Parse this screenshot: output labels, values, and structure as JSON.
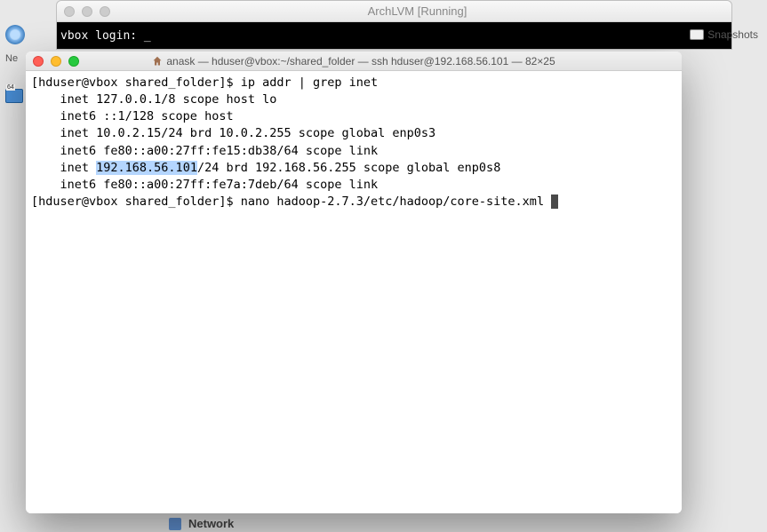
{
  "vm_window": {
    "title": "ArchLVM [Running]",
    "login_prompt": "vbox login: _"
  },
  "snapshots": {
    "label": "Snapshots"
  },
  "left": {
    "ne_label": "Ne"
  },
  "network": {
    "label": "Network"
  },
  "terminal": {
    "title": "anask — hduser@vbox:~/shared_folder — ssh hduser@192.168.56.101 — 82×25",
    "lines": {
      "l1_prompt": "[hduser@vbox shared_folder]$ ",
      "l1_cmd": "ip addr | grep inet",
      "l2": "    inet 127.0.0.1/8 scope host lo",
      "l3": "    inet6 ::1/128 scope host ",
      "l4": "    inet 10.0.2.15/24 brd 10.0.2.255 scope global enp0s3",
      "l5": "    inet6 fe80::a00:27ff:fe15:db38/64 scope link ",
      "l6_a": "    inet ",
      "l6_hl": "192.168.56.101",
      "l6_b": "/24 brd 192.168.56.255 scope global enp0s8",
      "l7": "    inet6 fe80::a00:27ff:fe7a:7deb/64 scope link ",
      "l8_prompt": "[hduser@vbox shared_folder]$ ",
      "l8_cmd": "nano hadoop-2.7.3/etc/hadoop/core-site.xml "
    }
  }
}
